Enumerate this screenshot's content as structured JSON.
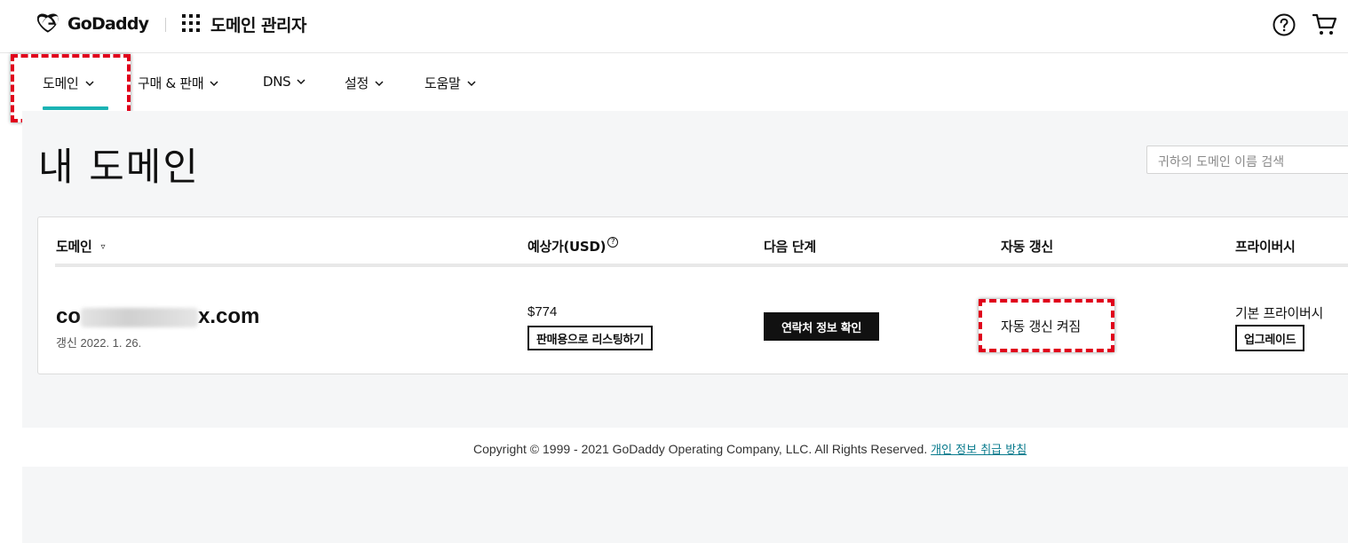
{
  "header": {
    "brand": "GoDaddy",
    "app_title": "도메인 관리자"
  },
  "nav": {
    "items": [
      {
        "label": "도메인"
      },
      {
        "label": "구매 & 판매"
      },
      {
        "label": "DNS"
      },
      {
        "label": "설정"
      },
      {
        "label": "도움말"
      }
    ],
    "active": "도메인"
  },
  "page": {
    "title": "내 도메인",
    "search_placeholder": "귀하의 도메인 이름 검색"
  },
  "table": {
    "columns": [
      "도메인",
      "예상가(USD)",
      "다음 단계",
      "자동 갱신",
      "프라이버시"
    ],
    "sort_indicator": "▿",
    "help_mark": "?",
    "row": {
      "domain_prefix": "co",
      "domain_suffix": "x.com",
      "renew_date": "갱신 2022. 1. 26.",
      "price": "$774",
      "list_for_sale": "판매용으로 리스팅하기",
      "next_step": "연락처 정보 확인",
      "auto_renew": "자동 갱신 켜짐",
      "privacy": "기본 프라이버시",
      "upgrade": "업그레이드"
    }
  },
  "footer": {
    "copyright": "Copyright © 1999 - 2021 GoDaddy Operating Company, LLC. All Rights Reserved.",
    "privacy_link": "개인 정보 취급 방침"
  },
  "colors": {
    "accent": "#1bb3b4",
    "highlight": "#e0001b",
    "link": "#097b8d"
  }
}
